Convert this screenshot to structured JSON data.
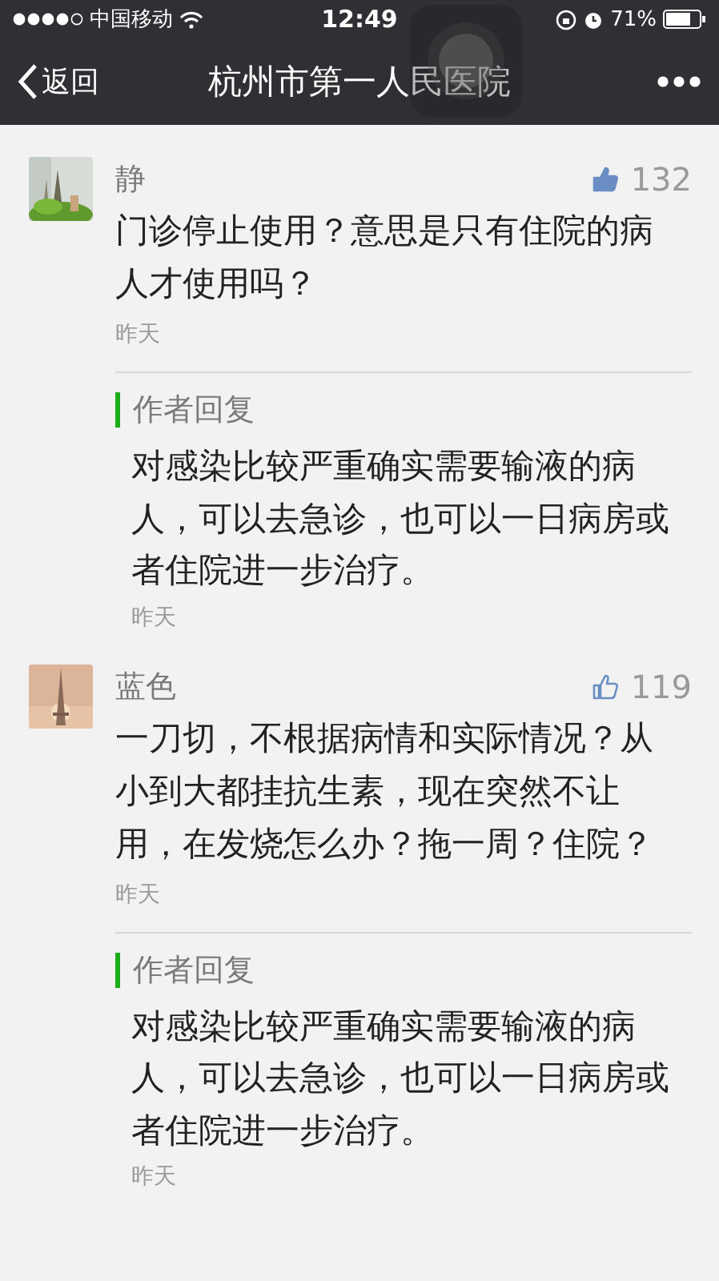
{
  "status_bar": {
    "carrier": "中国移动",
    "time": "12:49",
    "battery": "71%"
  },
  "nav": {
    "back": "返回",
    "title": "杭州市第一人民医院"
  },
  "comments": [
    {
      "author": "静",
      "likes": "132",
      "liked": true,
      "text": "门诊停止使用？意思是只有住院的病人才使用吗？",
      "time": "昨天",
      "reply": {
        "label": "作者回复",
        "text": "对感染比较严重确实需要输液的病人，可以去急诊，也可以一日病房或者住院进一步治疗。",
        "time": "昨天"
      }
    },
    {
      "author": "蓝色",
      "likes": "119",
      "liked": false,
      "text": "一刀切，不根据病情和实际情况？从小到大都挂抗生素，现在突然不让用，在发烧怎么办？拖一周？住院？",
      "time": "昨天",
      "reply": {
        "label": "作者回复",
        "text": "对感染比较严重确实需要输液的病人，可以去急诊，也可以一日病房或者住院进一步治疗。",
        "time": "昨天"
      }
    }
  ]
}
